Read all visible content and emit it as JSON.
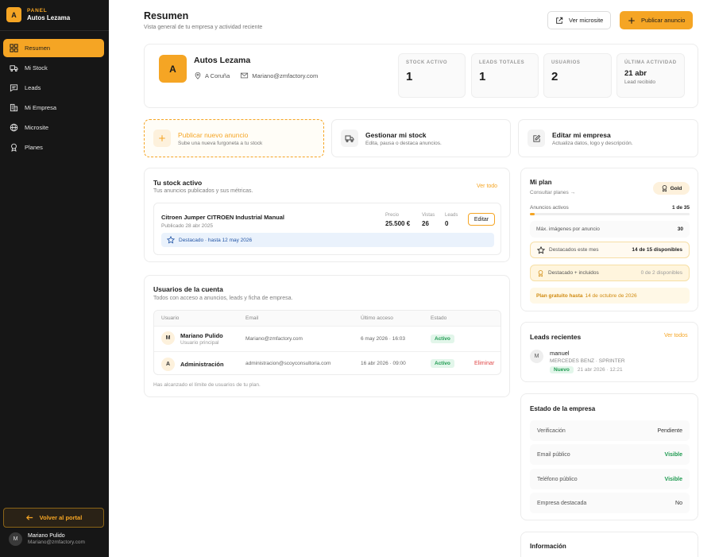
{
  "brand": {
    "kicker": "PANEL",
    "name": "Autos Lezama",
    "logo_letter": "A"
  },
  "sidebar": {
    "items": [
      {
        "label": "Resumen",
        "icon": "grid-icon",
        "active": true
      },
      {
        "label": "Mi Stock",
        "icon": "truck-icon"
      },
      {
        "label": "Leads",
        "icon": "message-icon"
      },
      {
        "label": "Mi Empresa",
        "icon": "building-icon"
      },
      {
        "label": "Microsite",
        "icon": "globe-icon"
      },
      {
        "label": "Planes",
        "icon": "award-icon"
      }
    ],
    "back_label": "Volver al portal",
    "user": {
      "initial": "M",
      "name": "Mariano Pulido",
      "email": "Mariano@zmfactory.com"
    }
  },
  "header": {
    "title": "Resumen",
    "subtitle": "Vista general de tu empresa y actividad reciente",
    "microsite_label": "Ver microsite",
    "publish_label": "Publicar anuncio"
  },
  "company": {
    "initial": "A",
    "name": "Autos Lezama",
    "location": "A Coruña",
    "email": "Mariano@zmfactory.com",
    "stats": [
      {
        "label": "STOCK ACTIVO",
        "value": "1"
      },
      {
        "label": "LEADS TOTALES",
        "value": "1"
      },
      {
        "label": "USUARIOS",
        "value": "2"
      },
      {
        "label": "ÚLTIMA ACTIVIDAD",
        "value": "21 abr",
        "sub": "Lead recibido"
      }
    ]
  },
  "actions": [
    {
      "title": "Publicar nuevo anuncio",
      "sub": "Sube una nueva furgoneta a tu stock"
    },
    {
      "title": "Gestionar mi stock",
      "sub": "Edita, pausa o destaca anuncios."
    },
    {
      "title": "Editar mi empresa",
      "sub": "Actualiza datos, logo y descripción."
    }
  ],
  "stock": {
    "title": "Tu stock activo",
    "subtitle": "Tus anuncios publicados y sus métricas.",
    "see_all": "Ver todo",
    "listing": {
      "name": "Citroen Jumper CITROEN Industrial Manual",
      "date": "Publicado 28 abr 2025",
      "price_label": "Precio",
      "price": "25.500 €",
      "views_label": "Vistas",
      "views": "26",
      "leads_label": "Leads",
      "leads": "0",
      "edit_label": "Editar",
      "featured": "Destacado · hasta 12 may 2026"
    }
  },
  "users": {
    "title": "Usuarios de la cuenta",
    "subtitle": "Todos con acceso a anuncios, leads y ficha de empresa.",
    "headers": [
      "Usuario",
      "Email",
      "Último acceso",
      "Estado"
    ],
    "rows": [
      {
        "initial": "M",
        "name": "Mariano Pulido",
        "role": "Usuario principal",
        "email": "Mariano@zmfactory.com",
        "last": "6 may 2026 · 16:03",
        "status": "Activo",
        "action": ""
      },
      {
        "initial": "A",
        "name": "Administración",
        "role": "",
        "email": "administracion@scoyconsultoria.com",
        "last": "16 abr 2026 · 09:00",
        "status": "Activo",
        "action": "Eliminar"
      }
    ],
    "footer": "Has alcanzado el límite de usuarios de tu plan."
  },
  "plan": {
    "title": "Mi plan",
    "link": "Consultar planes →",
    "badge": "Gold",
    "ads_label": "Anuncios activos",
    "ads_value": "1 de 35",
    "ads_fraction": 0.0286,
    "images_label": "Máx. imágenes por anuncio",
    "images_value": "30",
    "featured_label": "Destacados este mes",
    "featured_value": "14 de 15 disponibles",
    "included_label": "Destacado + incluidos",
    "included_value": "0 de 2 disponibles",
    "free_label": "Plan gratuito hasta",
    "free_date": "14 de octubre de 2026"
  },
  "leads": {
    "title": "Leads recientes",
    "see_all": "Ver todos",
    "item": {
      "initial": "M",
      "name": "manuel",
      "vehicle": "MERCEDES BENZ · SPRINTER",
      "badge": "Nuevo",
      "time": "21 abr 2026 · 12:21"
    }
  },
  "company_status": {
    "title": "Estado de la empresa",
    "rows": [
      {
        "label": "Verificación",
        "value": "Pendiente"
      },
      {
        "label": "Email público",
        "value": "Visible"
      },
      {
        "label": "Teléfono público",
        "value": "Visible"
      },
      {
        "label": "Empresa destacada",
        "value": "No"
      }
    ]
  },
  "info": {
    "title": "Información"
  },
  "colors": {
    "accent": "#f5a524",
    "sidebar": "#161616",
    "success": "#1e9a50",
    "danger": "#e04848"
  }
}
